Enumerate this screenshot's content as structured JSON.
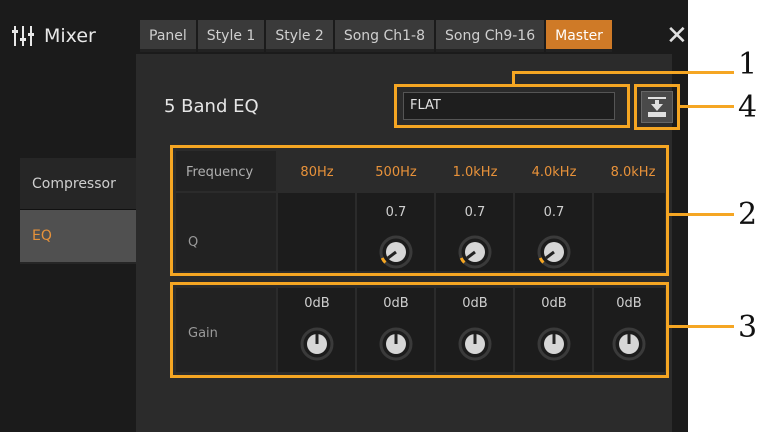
{
  "app": {
    "title": "Mixer",
    "icon": "mixer-sliders-icon"
  },
  "tabs": [
    {
      "label": "Panel",
      "active": false
    },
    {
      "label": "Style 1",
      "active": false
    },
    {
      "label": "Style 2",
      "active": false
    },
    {
      "label": "Song Ch1-8",
      "active": false
    },
    {
      "label": "Song Ch9-16",
      "active": false
    },
    {
      "label": "Master",
      "active": true
    }
  ],
  "close_symbol": "✕",
  "sidebar": {
    "items": [
      {
        "label": "Compressor",
        "selected": false
      },
      {
        "label": "EQ",
        "selected": true
      }
    ]
  },
  "section_title": "5 Band EQ",
  "preset": {
    "value": "FLAT"
  },
  "eq": {
    "frequency_label": "Frequency",
    "q_label": "Q",
    "gain_label": "Gain",
    "bands": [
      {
        "frequency": "80Hz",
        "q": "",
        "gain": "0dB"
      },
      {
        "frequency": "500Hz",
        "q": "0.7",
        "gain": "0dB"
      },
      {
        "frequency": "1.0kHz",
        "q": "0.7",
        "gain": "0dB"
      },
      {
        "frequency": "4.0kHz",
        "q": "0.7",
        "gain": "0dB"
      },
      {
        "frequency": "8.0kHz",
        "q": "",
        "gain": "0dB"
      }
    ]
  },
  "callouts": [
    "1",
    "2",
    "3",
    "4"
  ],
  "colors": {
    "accent": "#cf7a27",
    "frequency_text": "#e8923a",
    "highlight": "#f5a623"
  }
}
